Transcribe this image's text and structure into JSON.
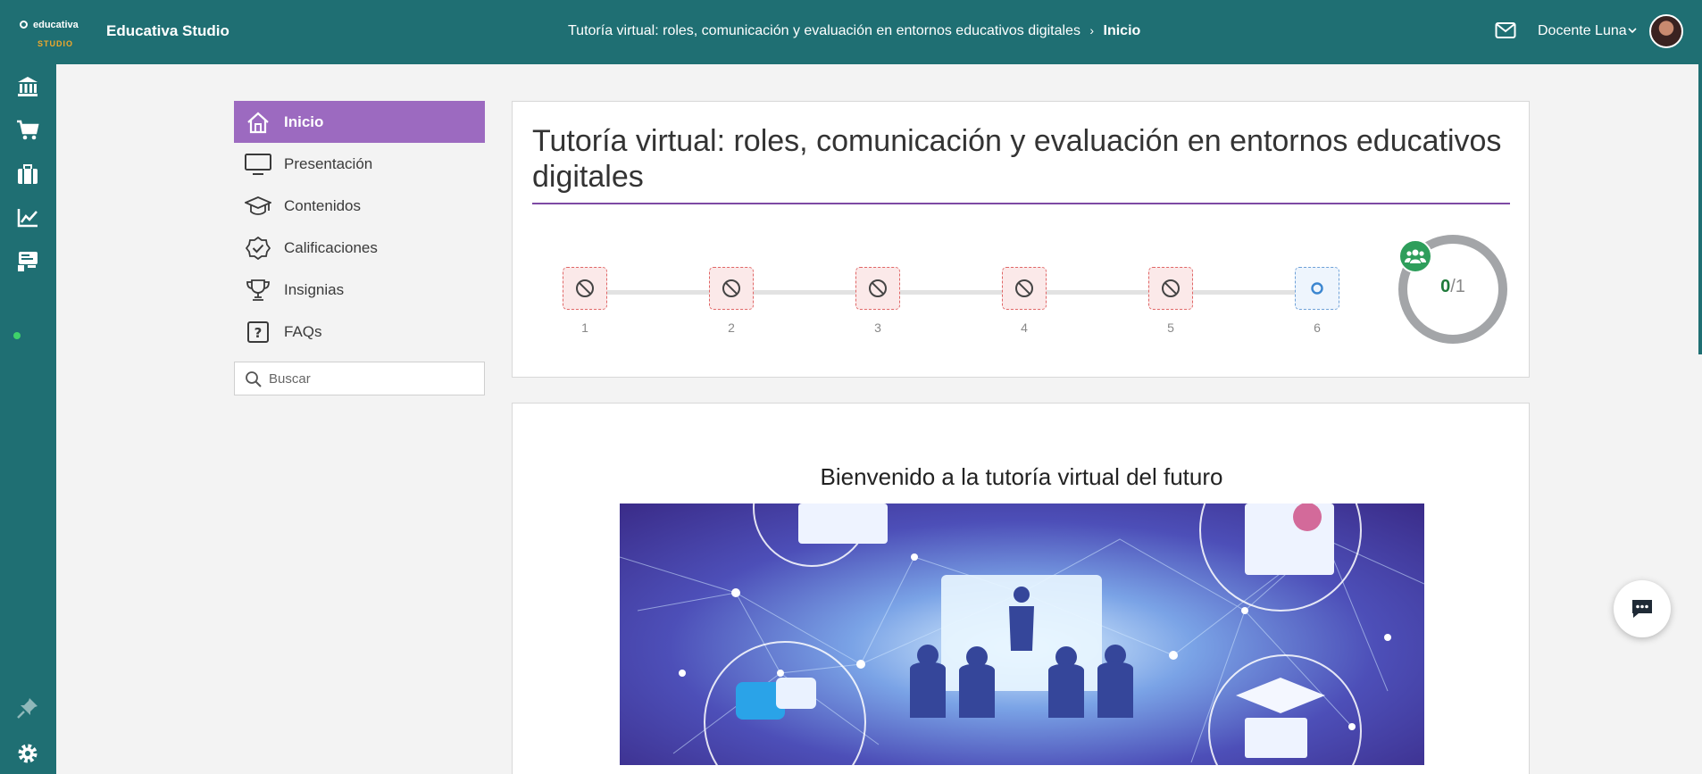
{
  "app": {
    "logo_text": "educativa",
    "logo_sub": "STUDIO",
    "title": "Educativa Studio"
  },
  "breadcrumb": {
    "course": "Tutoría virtual: roles, comunicación y evaluación en entornos educativos digitales",
    "current": "Inicio"
  },
  "user": {
    "name": "Docente Luna"
  },
  "rail": {
    "icons": [
      "institution-icon",
      "cart-icon",
      "briefcase-icon",
      "chart-icon",
      "classroom-icon",
      "pin-icon",
      "settings-icon"
    ]
  },
  "menu": {
    "items": [
      {
        "label": "Inicio",
        "icon": "home-icon",
        "active": true
      },
      {
        "label": "Presentación",
        "icon": "monitor-icon",
        "active": false
      },
      {
        "label": "Contenidos",
        "icon": "graduation-cap-icon",
        "active": false
      },
      {
        "label": "Calificaciones",
        "icon": "badge-check-icon",
        "active": false
      },
      {
        "label": "Insignias",
        "icon": "trophy-icon",
        "active": false
      },
      {
        "label": "FAQs",
        "icon": "question-icon",
        "active": false
      }
    ]
  },
  "search": {
    "placeholder": "Buscar"
  },
  "course": {
    "title": "Tutoría virtual: roles, comunicación y evaluación en entornos educativos digitales",
    "steps": [
      {
        "number": "1",
        "state": "blocked"
      },
      {
        "number": "2",
        "state": "blocked"
      },
      {
        "number": "3",
        "state": "blocked"
      },
      {
        "number": "4",
        "state": "blocked"
      },
      {
        "number": "5",
        "state": "blocked"
      },
      {
        "number": "6",
        "state": "open"
      }
    ],
    "progress": {
      "completed": "0",
      "total": "/1"
    }
  },
  "welcome": {
    "heading": "Bienvenido a la tutoría virtual del futuro"
  },
  "colors": {
    "topbar": "#1f6f73",
    "active_menu": "#9c6ac0",
    "title_rule": "#7d4aa4",
    "progress_count": "#1f7a3a"
  }
}
